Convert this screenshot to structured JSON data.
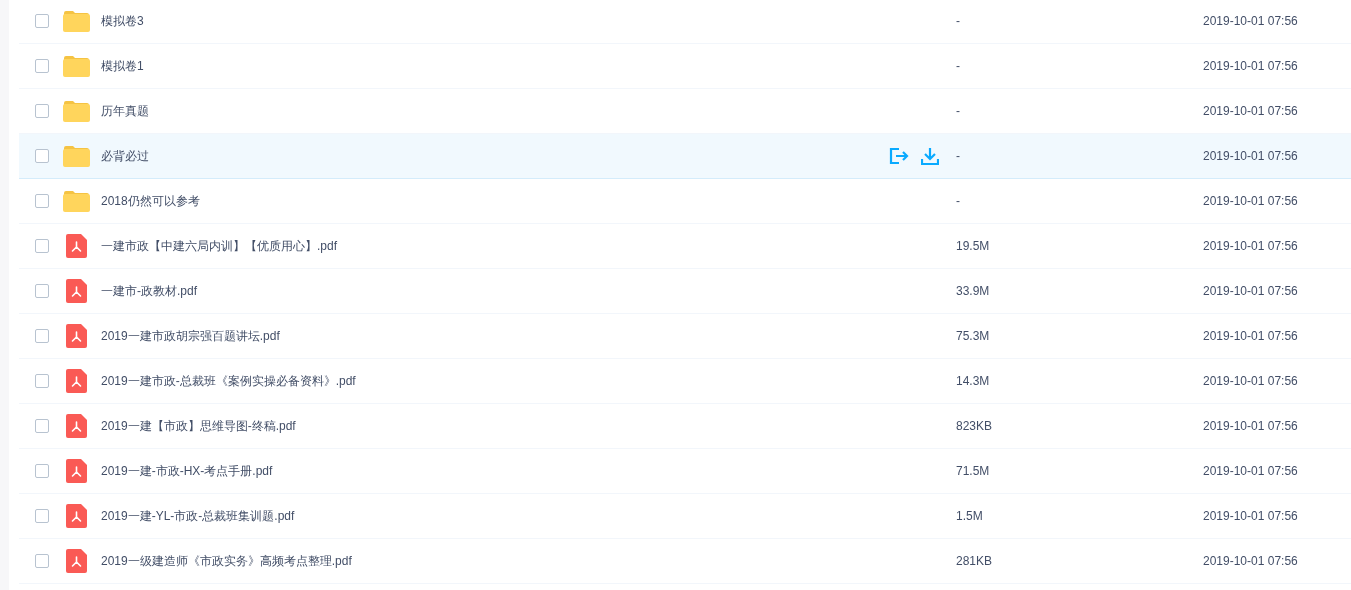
{
  "files": [
    {
      "kind": "folder",
      "name": "模拟卷3",
      "size": "-",
      "modified": "2019-10-01 07:56",
      "checked": false,
      "hovered": false
    },
    {
      "kind": "folder",
      "name": "模拟卷1",
      "size": "-",
      "modified": "2019-10-01 07:56",
      "checked": false,
      "hovered": false
    },
    {
      "kind": "folder",
      "name": "历年真题",
      "size": "-",
      "modified": "2019-10-01 07:56",
      "checked": false,
      "hovered": false
    },
    {
      "kind": "folder",
      "name": "必背必过",
      "size": "-",
      "modified": "2019-10-01 07:56",
      "checked": false,
      "hovered": true
    },
    {
      "kind": "folder",
      "name": "2018仍然可以参考",
      "size": "-",
      "modified": "2019-10-01 07:56",
      "checked": false,
      "hovered": false
    },
    {
      "kind": "pdf",
      "name": "一建市政【中建六局内训】【优质用心】.pdf",
      "size": "19.5M",
      "modified": "2019-10-01 07:56",
      "checked": false,
      "hovered": false
    },
    {
      "kind": "pdf",
      "name": "一建市-政教材.pdf",
      "size": "33.9M",
      "modified": "2019-10-01 07:56",
      "checked": false,
      "hovered": false
    },
    {
      "kind": "pdf",
      "name": "2019一建市政胡宗强百题讲坛.pdf",
      "size": "75.3M",
      "modified": "2019-10-01 07:56",
      "checked": false,
      "hovered": false
    },
    {
      "kind": "pdf",
      "name": "2019一建市政-总裁班《案例实操必备资料》.pdf",
      "size": "14.3M",
      "modified": "2019-10-01 07:56",
      "checked": false,
      "hovered": false
    },
    {
      "kind": "pdf",
      "name": "2019一建【市政】思维导图-终稿.pdf",
      "size": "823KB",
      "modified": "2019-10-01 07:56",
      "checked": false,
      "hovered": false
    },
    {
      "kind": "pdf",
      "name": "2019一建-市政-HX-考点手册.pdf",
      "size": "71.5M",
      "modified": "2019-10-01 07:56",
      "checked": false,
      "hovered": false
    },
    {
      "kind": "pdf",
      "name": "2019一建-YL-市政-总裁班集训题.pdf",
      "size": "1.5M",
      "modified": "2019-10-01 07:56",
      "checked": false,
      "hovered": false
    },
    {
      "kind": "pdf",
      "name": "2019一级建造师《市政实务》高频考点整理.pdf",
      "size": "281KB",
      "modified": "2019-10-01 07:56",
      "checked": false,
      "hovered": false
    }
  ]
}
